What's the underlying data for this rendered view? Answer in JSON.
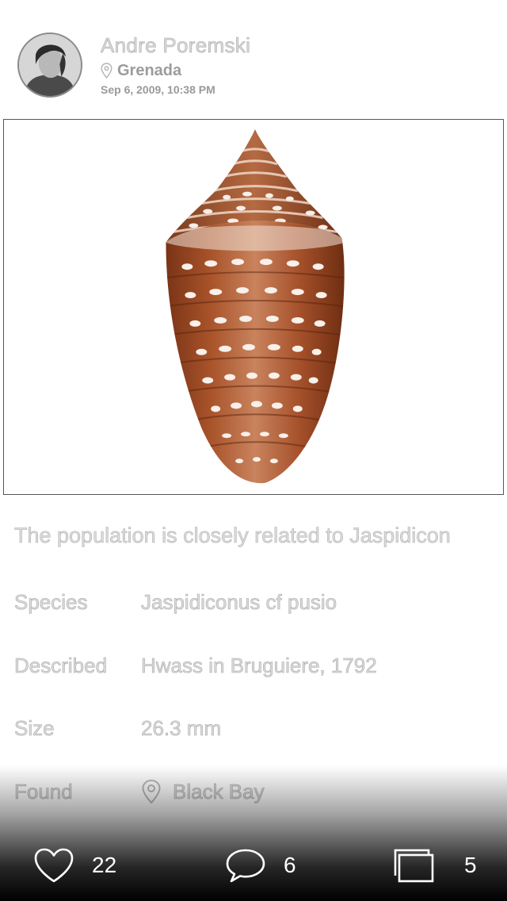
{
  "post": {
    "author": "Andre Poremski",
    "location": "Grenada",
    "timestamp": "Sep 6, 2009, 10:38 PM",
    "description": "The population is closely related to Jaspidicon"
  },
  "details": [
    {
      "label": "Species",
      "value": "Jaspidiconus cf pusio"
    },
    {
      "label": "Described",
      "value": "Hwass in Bruguiere, 1792"
    },
    {
      "label": "Size",
      "value": "26.3 mm"
    },
    {
      "label": "Found",
      "value": "Black Bay",
      "icon": "location-pin-icon"
    }
  ],
  "actions": {
    "likes": {
      "icon": "heart-icon",
      "count": "22"
    },
    "comments": {
      "icon": "comment-bubble-icon",
      "count": "6"
    },
    "collections": {
      "icon": "stacked-squares-icon",
      "count": "5"
    }
  },
  "colors": {
    "shell_brown": "#9a4a24",
    "shell_light": "#f3e3d8",
    "action_text": "#ffffff"
  }
}
